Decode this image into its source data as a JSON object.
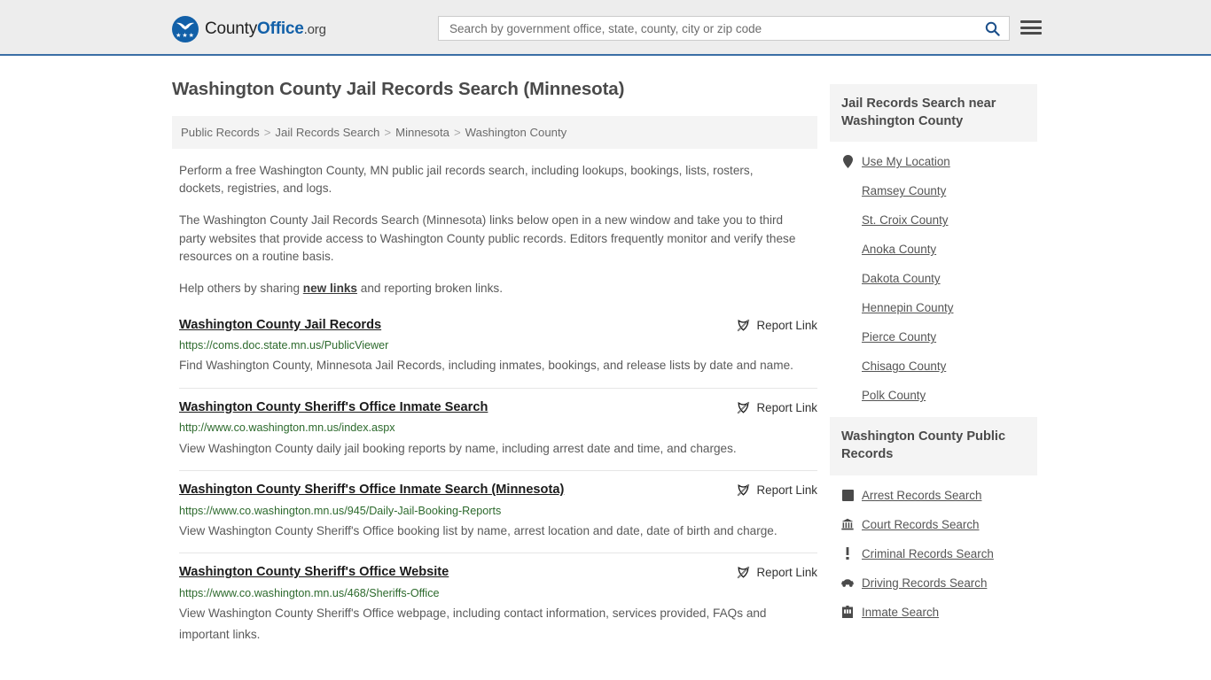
{
  "header": {
    "logo": {
      "part1": "County",
      "part2": "Office",
      "tld": ".org",
      "icon": "eagle-shield-icon"
    },
    "search": {
      "placeholder": "Search by government office, state, county, city or zip code",
      "value": ""
    },
    "search_icon": "search-icon",
    "menu_icon": "hamburger-menu-icon"
  },
  "page_title": "Washington County Jail Records Search (Minnesota)",
  "breadcrumb": {
    "items": [
      "Public Records",
      "Jail Records Search",
      "Minnesota",
      "Washington County"
    ],
    "separator": ">"
  },
  "intro": {
    "p1": "Perform a free Washington County, MN public jail records search, including lookups, bookings, lists, rosters, dockets, registries, and logs.",
    "p2": "The Washington County Jail Records Search (Minnesota) links below open in a new window and take you to third party websites that provide access to Washington County public records. Editors frequently monitor and verify these resources on a routine basis.",
    "p3_before": "Help others by sharing ",
    "p3_link": "new links",
    "p3_after": " and reporting broken links."
  },
  "report_link_label": "Report Link",
  "report_link_icon": "broken-link-icon",
  "results": [
    {
      "title": "Washington County Jail Records",
      "url": "https://coms.doc.state.mn.us/PublicViewer",
      "description": "Find Washington County, Minnesota Jail Records, including inmates, bookings, and release lists by date and name."
    },
    {
      "title": "Washington County Sheriff's Office Inmate Search",
      "url": "http://www.co.washington.mn.us/index.aspx",
      "description": "View Washington County daily jail booking reports by name, including arrest date and time, and charges."
    },
    {
      "title": "Washington County Sheriff's Office Inmate Search (Minnesota)",
      "url": "https://www.co.washington.mn.us/945/Daily-Jail-Booking-Reports",
      "description": "View Washington County Sheriff's Office booking list by name, arrest location and date, date of birth and charge."
    },
    {
      "title": "Washington County Sheriff's Office Website",
      "url": "https://www.co.washington.mn.us/468/Sheriffs-Office",
      "description": "View Washington County Sheriff's Office webpage, including contact information, services provided, FAQs and important links."
    }
  ],
  "sidebar": {
    "card1": {
      "title": "Jail Records Search near Washington County",
      "items": [
        {
          "label": "Use My Location",
          "icon": "map-pin-icon"
        },
        {
          "label": "Ramsey County",
          "icon": "none"
        },
        {
          "label": "St. Croix County",
          "icon": "none"
        },
        {
          "label": "Anoka County",
          "icon": "none"
        },
        {
          "label": "Dakota County",
          "icon": "none"
        },
        {
          "label": "Hennepin County",
          "icon": "none"
        },
        {
          "label": "Pierce County",
          "icon": "none"
        },
        {
          "label": "Chisago County",
          "icon": "none"
        },
        {
          "label": "Polk County",
          "icon": "none"
        }
      ]
    },
    "card2": {
      "title": "Washington County Public Records",
      "items": [
        {
          "label": "Arrest Records Search",
          "icon": "fingerprint-icon"
        },
        {
          "label": "Court Records Search",
          "icon": "courthouse-icon"
        },
        {
          "label": "Criminal Records Search",
          "icon": "exclamation-icon"
        },
        {
          "label": "Driving Records Search",
          "icon": "car-icon"
        },
        {
          "label": "Inmate Search",
          "icon": "jail-building-icon"
        }
      ]
    }
  },
  "colors": {
    "brand_blue": "#1260a8",
    "header_bg": "#ededed",
    "header_border": "#3a6ea5",
    "url_green": "#2d6a2d",
    "card_bg": "#f4f4f4",
    "body_text": "#5a5a5a"
  }
}
